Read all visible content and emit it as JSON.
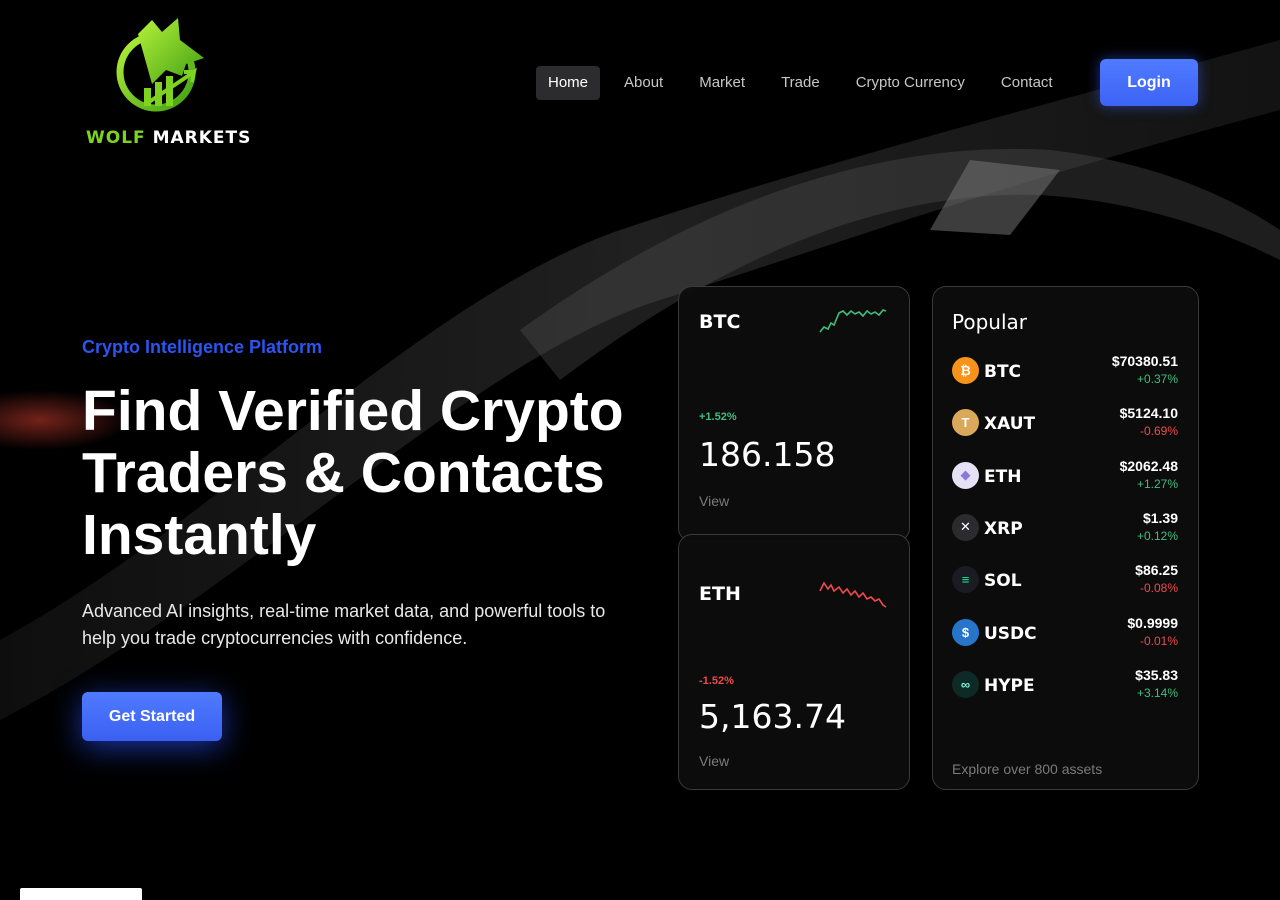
{
  "brand": {
    "name_part1": "WOLF",
    "name_part2": "MARKETS",
    "logo_icon": "wolf-chart-logo"
  },
  "nav": {
    "items": [
      {
        "label": "Home",
        "active": true
      },
      {
        "label": "About",
        "active": false
      },
      {
        "label": "Market",
        "active": false
      },
      {
        "label": "Trade",
        "active": false
      },
      {
        "label": "Crypto Currency",
        "active": false
      },
      {
        "label": "Contact",
        "active": false
      }
    ],
    "login_label": "Login"
  },
  "hero": {
    "eyebrow": "Crypto Intelligence Platform",
    "headline": "Find Verified Crypto Traders & Contacts Instantly",
    "subtext": "Advanced AI insights, real-time market data, and powerful tools to help you trade cryptocurrencies with confidence.",
    "cta_label": "Get Started"
  },
  "coin_cards": {
    "btc": {
      "symbol": "BTC",
      "change": "+1.52%",
      "value": "186.158",
      "view_label": "View",
      "trend": "up"
    },
    "eth": {
      "symbol": "ETH",
      "change": "-1.52%",
      "value": "5,163.74",
      "view_label": "View",
      "trend": "down"
    }
  },
  "popular": {
    "title": "Popular",
    "assets": [
      {
        "symbol": "BTC",
        "price": "$70380.51",
        "change": "+0.37%",
        "direction": "up",
        "icon": "bitcoin-icon",
        "icon_color": "#f7931a",
        "glyph": "₿"
      },
      {
        "symbol": "XAUT",
        "price": "$5124.10",
        "change": "-0.69%",
        "direction": "down",
        "icon": "tether-gold-icon",
        "icon_color": "#d9a85b",
        "glyph": "T"
      },
      {
        "symbol": "ETH",
        "price": "$2062.48",
        "change": "+1.27%",
        "direction": "up",
        "icon": "ethereum-icon",
        "icon_color": "#e6e1f5",
        "glyph": "◆"
      },
      {
        "symbol": "XRP",
        "price": "$1.39",
        "change": "+0.12%",
        "direction": "up",
        "icon": "xrp-icon",
        "icon_color": "#2b2b2f",
        "glyph": "✕"
      },
      {
        "symbol": "SOL",
        "price": "$86.25",
        "change": "-0.08%",
        "direction": "down",
        "icon": "solana-icon",
        "icon_color": "#1b1b24",
        "glyph": "≡"
      },
      {
        "symbol": "USDC",
        "price": "$0.9999",
        "change": "-0.01%",
        "direction": "down",
        "icon": "usdc-icon",
        "icon_color": "#2775ca",
        "glyph": "$"
      },
      {
        "symbol": "HYPE",
        "price": "$35.83",
        "change": "+3.14%",
        "direction": "up",
        "icon": "hype-icon",
        "icon_color": "#0e2a26",
        "glyph": "∞"
      }
    ],
    "explore_label": "Explore over 800 assets"
  },
  "colors": {
    "accent_blue": "#3d63f5",
    "eyebrow_blue": "#2c54f0",
    "brand_green": "#7ed321",
    "positive": "#3fbf7f",
    "negative": "#ec4b4b"
  }
}
